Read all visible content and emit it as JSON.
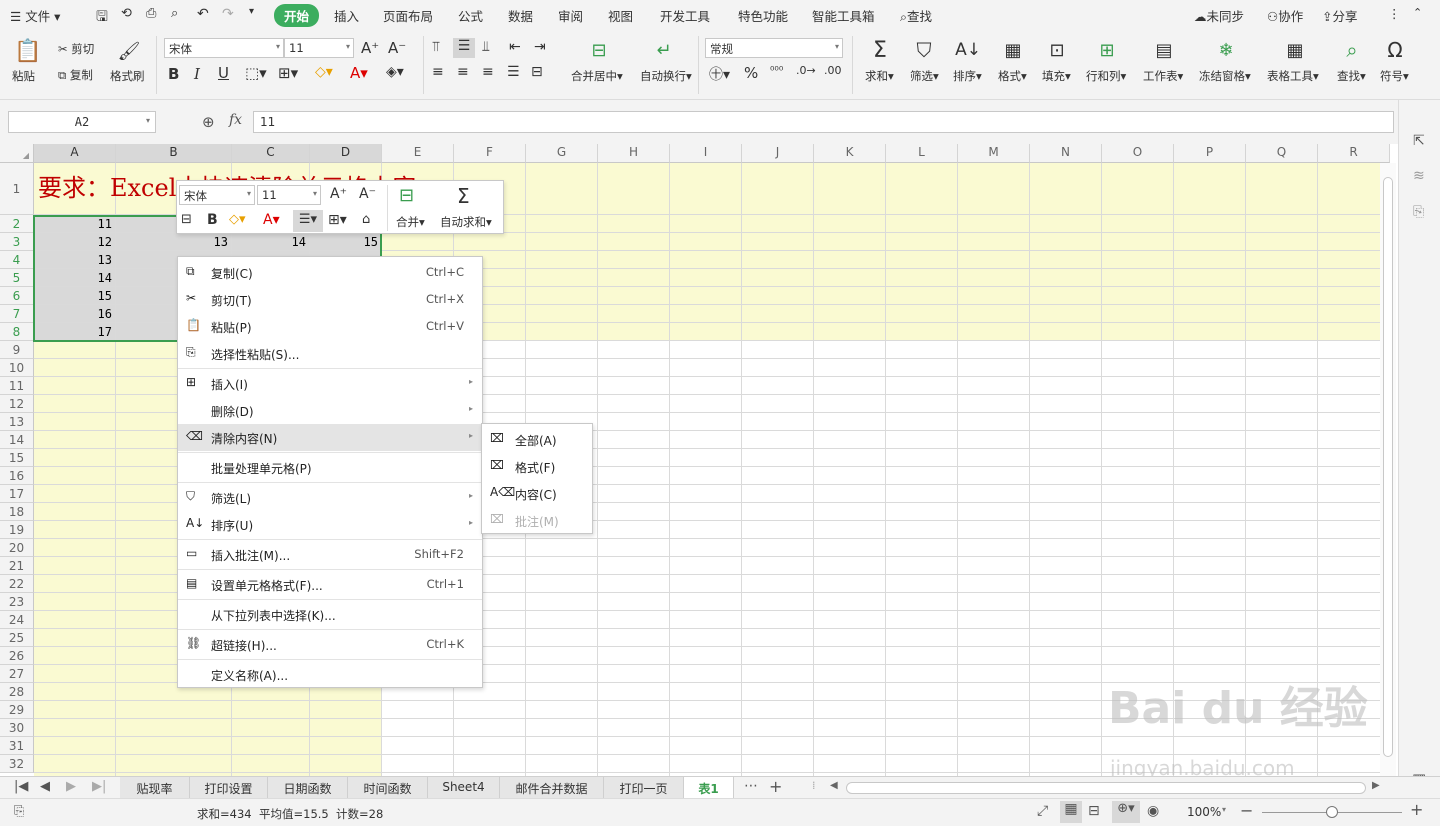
{
  "menubar": {
    "file": "文件",
    "tabs": [
      "开始",
      "插入",
      "页面布局",
      "公式",
      "数据",
      "审阅",
      "视图",
      "开发工具",
      "特色功能",
      "智能工具箱"
    ],
    "search": "查找",
    "unsynced": "未同步",
    "collab": "协作",
    "share": "分享"
  },
  "ribbon": {
    "paste": "粘贴",
    "cut": "剪切",
    "copy": "复制",
    "format_painter": "格式刷",
    "font_name": "宋体",
    "font_size": "11",
    "merge_center": "合并居中",
    "wrap_text": "自动换行",
    "number_format": "常规",
    "sum": "求和",
    "filter": "筛选",
    "sort": "排序",
    "format": "格式",
    "fill": "填充",
    "rowcol": "行和列",
    "worksheet": "工作表",
    "freeze": "冻结窗格",
    "table_tools": "表格工具",
    "find": "查找",
    "symbol": "符号"
  },
  "formula_bar": {
    "name_box": "A2",
    "fx": "fx",
    "value": "11"
  },
  "columns": [
    "A",
    "B",
    "C",
    "D",
    "E",
    "F",
    "G",
    "H",
    "I",
    "J",
    "K",
    "L",
    "M",
    "N",
    "O",
    "P",
    "Q",
    "R"
  ],
  "rows": [
    "1",
    "2",
    "3",
    "4",
    "5",
    "6",
    "7",
    "8",
    "9",
    "10",
    "11",
    "12",
    "13",
    "14",
    "15",
    "16",
    "17",
    "18",
    "19",
    "20",
    "21",
    "22",
    "23",
    "24",
    "25",
    "26",
    "27",
    "28",
    "29",
    "30",
    "31",
    "32"
  ],
  "cells": {
    "a1": "要求：Excel中快速清除单元格内容",
    "colA": [
      "11",
      "12",
      "13",
      "14",
      "15",
      "16",
      "17"
    ],
    "row3": [
      "13",
      "14",
      "15"
    ]
  },
  "mini_toolbar": {
    "font_name": "宋体",
    "font_size": "11",
    "merge": "合并",
    "autosum": "自动求和"
  },
  "context_menu": [
    {
      "label": "复制(C)",
      "shortcut": "Ctrl+C"
    },
    {
      "label": "剪切(T)",
      "shortcut": "Ctrl+X"
    },
    {
      "label": "粘贴(P)",
      "shortcut": "Ctrl+V"
    },
    {
      "label": "选择性粘贴(S)...",
      "shortcut": ""
    },
    {
      "label": "插入(I)",
      "shortcut": ""
    },
    {
      "label": "删除(D)",
      "shortcut": ""
    },
    {
      "label": "清除内容(N)",
      "shortcut": ""
    },
    {
      "label": "批量处理单元格(P)",
      "shortcut": ""
    },
    {
      "label": "筛选(L)",
      "shortcut": ""
    },
    {
      "label": "排序(U)",
      "shortcut": ""
    },
    {
      "label": "插入批注(M)...",
      "shortcut": "Shift+F2"
    },
    {
      "label": "设置单元格格式(F)...",
      "shortcut": "Ctrl+1"
    },
    {
      "label": "从下拉列表中选择(K)...",
      "shortcut": ""
    },
    {
      "label": "超链接(H)...",
      "shortcut": "Ctrl+K"
    },
    {
      "label": "定义名称(A)...",
      "shortcut": ""
    }
  ],
  "submenu": [
    {
      "label": "全部(A)"
    },
    {
      "label": "格式(F)"
    },
    {
      "label": "内容(C)"
    },
    {
      "label": "批注(M)"
    }
  ],
  "sheet_tabs": [
    "贴现率",
    "打印设置",
    "日期函数",
    "时间函数",
    "Sheet4",
    "邮件合并数据",
    "打印一页",
    "表1"
  ],
  "status": {
    "sum": "求和=434",
    "avg": "平均值=15.5",
    "count": "计数=28",
    "zoom": "100%"
  },
  "watermark": {
    "brand": "Bai du 经验",
    "url": "jingyan.baidu.com"
  },
  "colors": {
    "accent": "#3cad5f",
    "cell_fill": "#fafad2",
    "selection": "#d9d9d9",
    "title_red": "#c00000"
  }
}
